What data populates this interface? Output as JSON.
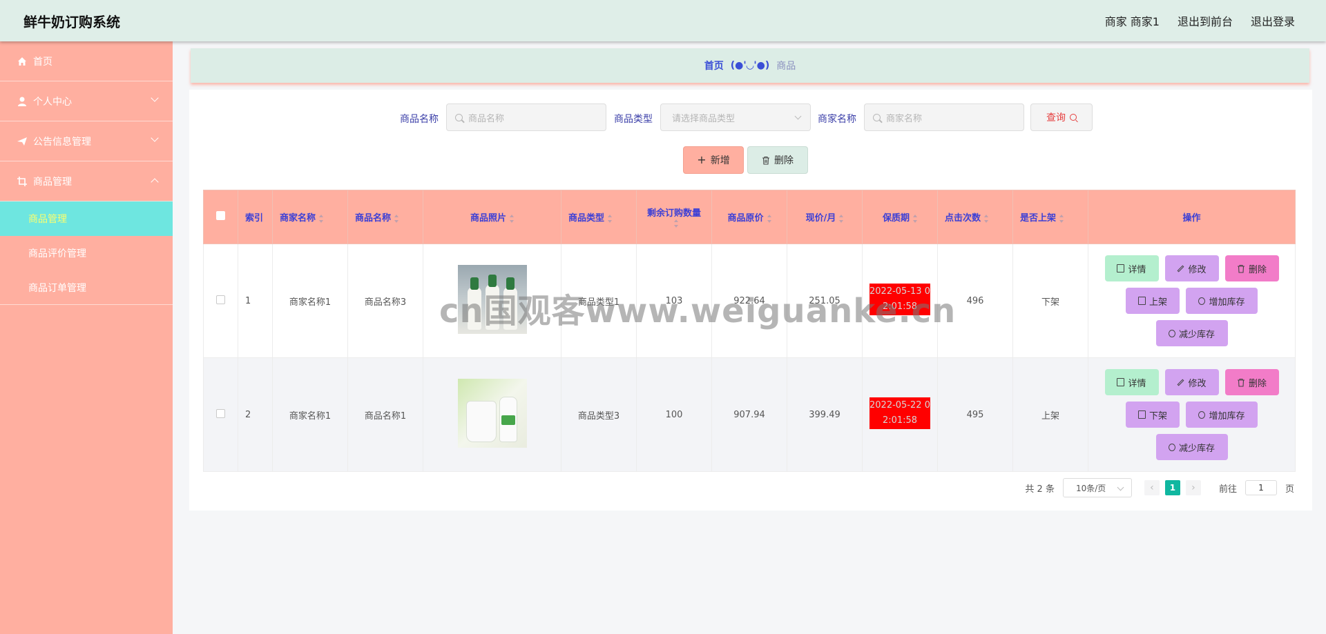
{
  "app": {
    "title": "鲜牛奶订购系统",
    "user_label": "商家 商家1",
    "front_link": "退出到前台",
    "logout_link": "退出登录"
  },
  "sidebar": {
    "items": [
      {
        "label": "首页",
        "icon": "home-icon"
      },
      {
        "label": "个人中心",
        "icon": "user-icon"
      },
      {
        "label": "公告信息管理",
        "icon": "send-icon"
      },
      {
        "label": "商品管理",
        "icon": "crop-icon"
      }
    ],
    "sub_items": [
      {
        "label": "商品管理",
        "active": true
      },
      {
        "label": "商品评价管理",
        "active": false
      },
      {
        "label": "商品订单管理",
        "active": false
      }
    ]
  },
  "breadcrumb": {
    "home": "首页",
    "separator": "(●'◡'●)",
    "current": "商品"
  },
  "search": {
    "product_name_label": "商品名称",
    "product_name_placeholder": "商品名称",
    "product_type_label": "商品类型",
    "product_type_placeholder": "请选择商品类型",
    "merchant_name_label": "商家名称",
    "merchant_name_placeholder": "商家名称",
    "query_button": "查询"
  },
  "actions": {
    "add_button": "新增",
    "delete_button": "删除"
  },
  "table": {
    "headers": {
      "index": "索引",
      "merchant": "商家名称",
      "product": "商品名称",
      "photo": "商品照片",
      "type": "商品类型",
      "remaining": "剩余订购数量",
      "original_price": "商品原价",
      "current_price": "现价/月",
      "expiry": "保质期",
      "clicks": "点击次数",
      "on_shelf": "是否上架",
      "ops": "操作"
    },
    "rows": [
      {
        "index": "1",
        "merchant": "商家名称1",
        "product": "商品名称3",
        "type": "商品类型1",
        "remaining": "103",
        "original_price": "922.64",
        "current_price": "251.05",
        "expiry": "2022-05-13 02:01:58",
        "clicks": "496",
        "on_shelf": "下架",
        "shelf_action": "上架"
      },
      {
        "index": "2",
        "merchant": "商家名称1",
        "product": "商品名称1",
        "type": "商品类型3",
        "remaining": "100",
        "original_price": "907.94",
        "current_price": "399.49",
        "expiry": "2022-05-22 02:01:58",
        "clicks": "495",
        "on_shelf": "上架",
        "shelf_action": "下架"
      }
    ],
    "op_labels": {
      "detail": "详情",
      "edit": "修改",
      "delete": "删除",
      "add_stock": "增加库存",
      "reduce_stock": "减少库存"
    }
  },
  "pagination": {
    "total": "共 2 条",
    "page_size": "10条/页",
    "prev": "‹",
    "current_page": "1",
    "next": "›",
    "goto_label": "前往",
    "goto_value": "1",
    "page_suffix": "页"
  },
  "watermark": "cn国观客www.weiguanke.cn",
  "colors": {
    "sidebar": "#ffafa0",
    "header": "#dfeee8",
    "active_sub": "#6ee6e0",
    "expiry": "#ff0000",
    "page_active": "#10b7a0"
  }
}
